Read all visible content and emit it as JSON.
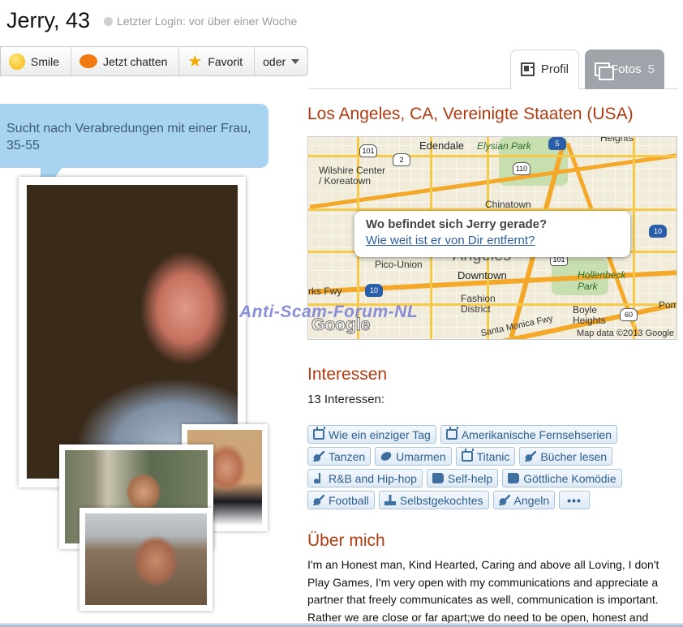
{
  "profile": {
    "name_age": "Jerry, 43",
    "last_login": "Letzter Login: vor über einer Woche"
  },
  "actions": [
    {
      "label": "Smile",
      "icon": "smiley-icon"
    },
    {
      "label": "Jetzt chatten",
      "icon": "chat-bubble-icon"
    },
    {
      "label": "Favorit",
      "icon": "star-icon"
    },
    {
      "label": "oder",
      "icon": "chevron-down-icon"
    }
  ],
  "tabs": {
    "profile": {
      "label": "Profil"
    },
    "photos": {
      "label": "Fotos",
      "count": "5"
    }
  },
  "seeking": "Sucht nach Verabredungen mit einer Frau, 35-55",
  "location": "Los Angeles, CA, Vereinigte Staaten (USA)",
  "map": {
    "question": "Wo befindet sich Jerry gerade?",
    "link": "Wie weit ist er von Dir entfernt?",
    "labels": {
      "edendale": "Edendale",
      "elysian": "Elysian Park",
      "heights": "Heights",
      "wilshire": "Wilshire Center\n/ Koreatown",
      "chinatown": "Chinatown",
      "pico": "Pico-Union",
      "angeles": "Angeles",
      "downtown": "Downtown",
      "hollenbeck": "Hollenbeck\nPark",
      "fwy": "rks Fwy",
      "fashion": "Fashion\nDistrict",
      "boyle": "Boyle\nHeights",
      "santa_monica": "Santa Monica Fwy",
      "pom": "Pom"
    },
    "shields": [
      "101",
      "2",
      "5",
      "110",
      "10",
      "101",
      "10",
      "60"
    ],
    "logo": "Google",
    "copyright": "Map data ©2013 Google"
  },
  "watermark": "Anti-Scam-Forum-NL",
  "interests": {
    "heading": "Interessen",
    "count_text": "13 Interessen:",
    "items": [
      {
        "label": "Wie ein einziger Tag",
        "icon": "tv-icon"
      },
      {
        "label": "Amerikanische Fernsehserien",
        "icon": "tv-icon"
      },
      {
        "label": "Tanzen",
        "icon": "guitar-icon"
      },
      {
        "label": "Umarmen",
        "icon": "ball-icon"
      },
      {
        "label": "Titanic",
        "icon": "tv-icon"
      },
      {
        "label": "Bücher lesen",
        "icon": "guitar-icon"
      },
      {
        "label": "R&B and Hip-hop",
        "icon": "music-note-icon"
      },
      {
        "label": "Self-help",
        "icon": "book-icon"
      },
      {
        "label": "Göttliche Komödie",
        "icon": "book-icon"
      },
      {
        "label": "Football",
        "icon": "guitar-icon"
      },
      {
        "label": "Selbstgekochtes",
        "icon": "food-icon"
      },
      {
        "label": "Angeln",
        "icon": "guitar-icon"
      }
    ],
    "more": "•••"
  },
  "about": {
    "heading": "Über mich",
    "text": "I'm an Honest man, Kind Hearted, Caring and above all Loving, I don't Play Games, I'm very open with my communications and appreciate a partner that freely communicates as well, communication is important. Rather we are close or far apart;we do need to be open, honest and"
  }
}
